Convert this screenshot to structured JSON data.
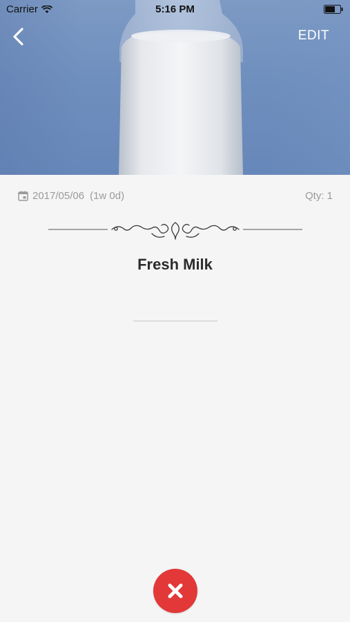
{
  "status_bar": {
    "carrier": "Carrier",
    "time": "5:16 PM"
  },
  "nav": {
    "back_icon": "chevron-left-icon",
    "edit_label": "EDIT"
  },
  "hero": {
    "image": "milk-bottle-photo",
    "background_color": "#6f8fbe"
  },
  "item": {
    "date": "2017/05/06",
    "age": "(1w 0d)",
    "qty": "Qty: 1",
    "title": "Fresh Milk"
  },
  "actions": {
    "delete_icon": "close-icon",
    "delete_color": "#e23838"
  }
}
